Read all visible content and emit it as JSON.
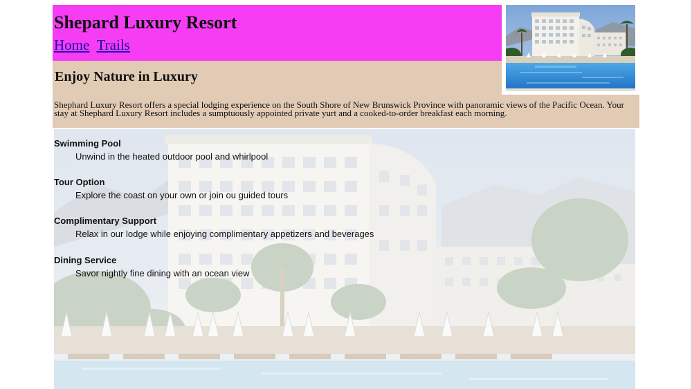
{
  "site": {
    "title": "Shepard Luxury Resort",
    "header_color": "#f63df4",
    "panel_color": "#e1cbb4"
  },
  "nav": {
    "items": [
      {
        "label": "Home"
      },
      {
        "label": "Trails"
      }
    ]
  },
  "hero": {
    "image": "resort-hotel-pool-photo"
  },
  "subhead": {
    "title": "Enjoy Nature in Luxury"
  },
  "intro": {
    "text": "Shephard Luxury Resort offers a special lodging experience on the South Shore of New Brunswick Province with panoramic views of the Pacific Ocean. Your stay at Shephard Luxury Resort includes a sumptuously appointed private yurt and a cooked-to-order breakfast each morning."
  },
  "amenities": {
    "background_image": "faded-resort-hotel-photo",
    "items": [
      {
        "title": "Swimming Pool",
        "description": "Unwind in the heated outdoor pool and whirlpool"
      },
      {
        "title": "Tour Option",
        "description": "Explore the coast on your own or join ou guided tours"
      },
      {
        "title": "Complimentary Support",
        "description": "Relax in our lodge while enjoying complimentary appetizers and beverages"
      },
      {
        "title": "Dining Service",
        "description": "Savor nightly fine dining with an ocean view"
      }
    ]
  }
}
